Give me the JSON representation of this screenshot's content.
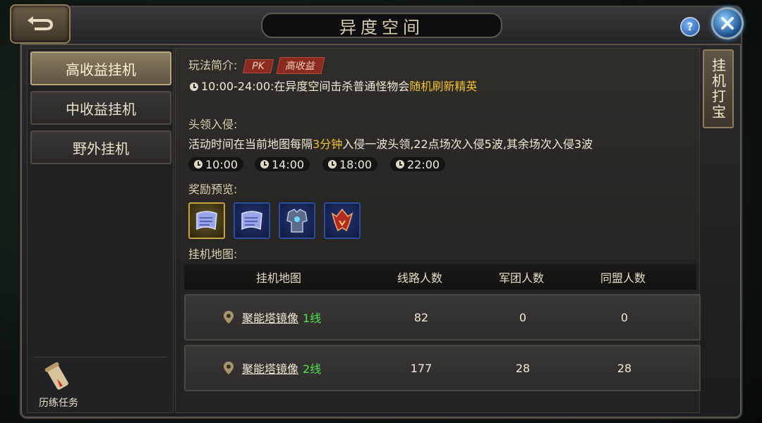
{
  "header": {
    "title": "异度空间"
  },
  "sidebar": {
    "items": [
      {
        "label": "高收益挂机",
        "active": true
      },
      {
        "label": "中收益挂机",
        "active": false
      },
      {
        "label": "野外挂机",
        "active": false
      }
    ],
    "task_label": "历练任务"
  },
  "right_tab": {
    "label": "挂机打宝"
  },
  "intro": {
    "label": "玩法简介:",
    "tags": [
      "PK",
      "高收益"
    ],
    "time_text": "10:00-24:00:在异度空间击杀普通怪物会",
    "time_highlight": "随机刷新精英"
  },
  "boss": {
    "label": "头领入侵:",
    "desc_prefix": "活动时间在当前地图每隔",
    "desc_highlight": "3分钟",
    "desc_suffix": "入侵一波头领,22点场次入侵5波,其余场次入侵3波",
    "times": [
      "10:00",
      "14:00",
      "18:00",
      "22:00"
    ]
  },
  "rewards": {
    "label": "奖励预览:",
    "items": [
      "scroll-icon",
      "scroll-icon",
      "armor-icon",
      "helmet-icon"
    ]
  },
  "maps": {
    "label": "挂机地图:",
    "headers": [
      "挂机地图",
      "线路人数",
      "军团人数",
      "同盟人数"
    ],
    "rows": [
      {
        "name": "聚能塔镜像",
        "line": "1线",
        "line_count": "82",
        "legion_count": "0",
        "alliance_count": "0"
      },
      {
        "name": "聚能塔镜像",
        "line": "2线",
        "line_count": "177",
        "legion_count": "28",
        "alliance_count": "28"
      }
    ]
  },
  "colors": {
    "highlight": "#f2c230",
    "line_green": "#4ee24e",
    "tag_red": "#8a2a20"
  }
}
